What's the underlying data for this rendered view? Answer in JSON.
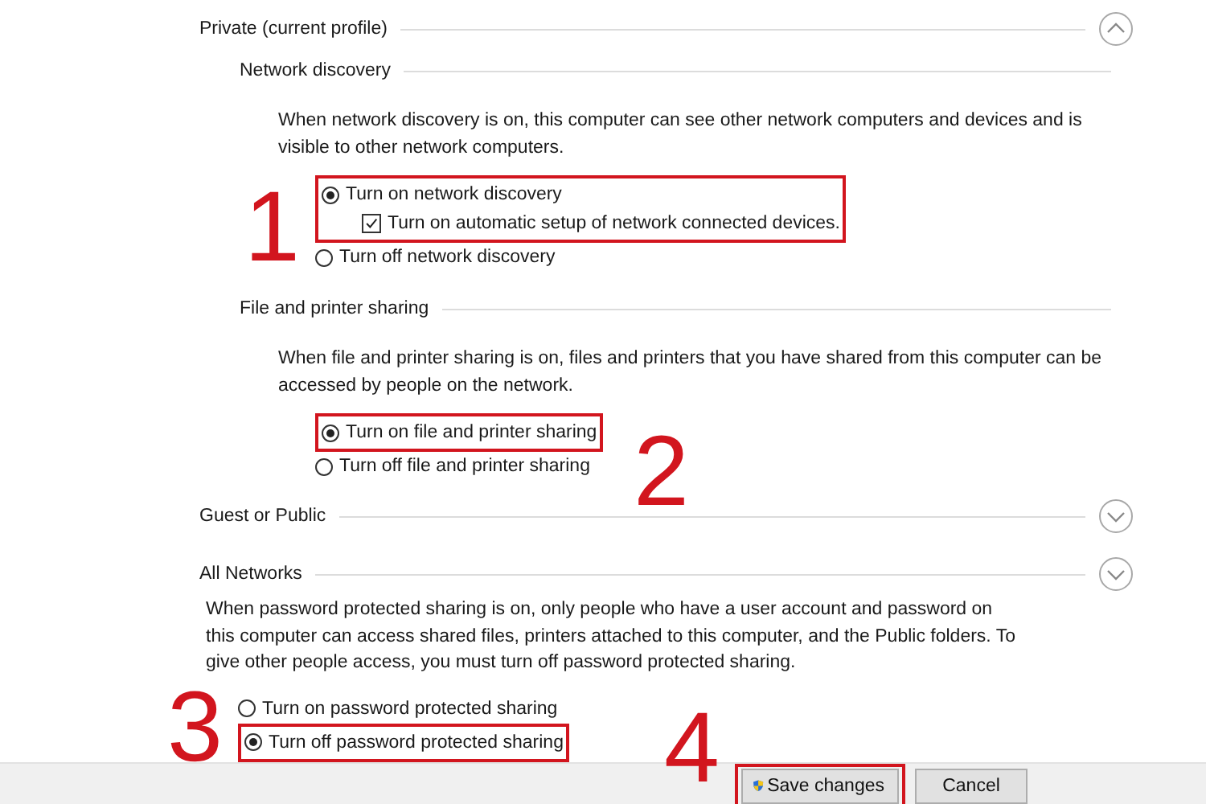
{
  "sections": [
    {
      "title": "Private (current profile)",
      "expanded": true,
      "groups": [
        {
          "title": "Network discovery",
          "description": "When network discovery is on, this computer can see other network computers and devices and is visible to other network computers.",
          "options": [
            {
              "kind": "radio",
              "label": "Turn on network discovery",
              "selected": true,
              "callout": "1",
              "children": [
                {
                  "kind": "checkbox",
                  "label": "Turn on automatic setup of network connected devices.",
                  "checked": true
                }
              ]
            },
            {
              "kind": "radio",
              "label": "Turn off network discovery",
              "selected": false
            }
          ]
        },
        {
          "title": "File and printer sharing",
          "description": "When file and printer sharing is on, files and printers that you have shared from this computer can be accessed by people on the network.",
          "options": [
            {
              "kind": "radio",
              "label": "Turn on file and printer sharing",
              "selected": true,
              "callout": "2"
            },
            {
              "kind": "radio",
              "label": "Turn off file and printer sharing",
              "selected": false
            }
          ]
        }
      ]
    },
    {
      "title": "Guest or Public",
      "expanded": false
    },
    {
      "title": "All Networks",
      "expanded": false,
      "description": "When password protected sharing is on, only people who have a user account and password on this computer can access shared files, printers attached to this computer, and the Public folders. To give other people access, you must turn off password protected sharing.",
      "options": [
        {
          "kind": "radio",
          "label": "Turn on password protected sharing",
          "selected": false
        },
        {
          "kind": "radio",
          "label": "Turn off password protected sharing",
          "selected": true,
          "callout": "3"
        }
      ]
    }
  ],
  "buttons": [
    {
      "label": "Save changes",
      "kind": "shield",
      "callout": "4"
    },
    {
      "label": "Cancel",
      "kind": "plain"
    }
  ]
}
